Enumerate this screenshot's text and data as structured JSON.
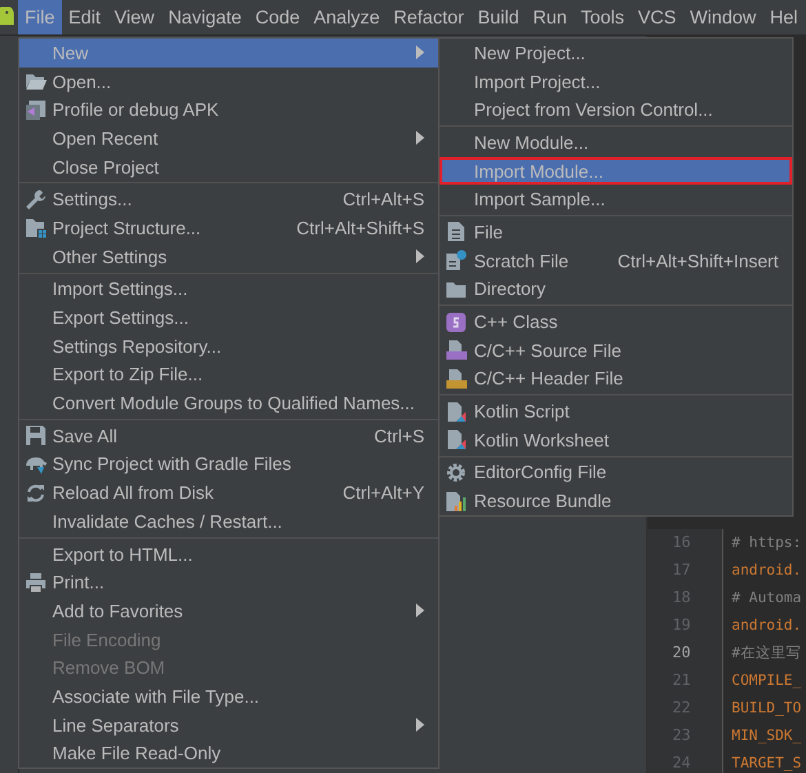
{
  "menu_bar": [
    {
      "label": "File",
      "selected": true
    },
    {
      "label": "Edit",
      "selected": false
    },
    {
      "label": "View",
      "selected": false
    },
    {
      "label": "Navigate",
      "selected": false
    },
    {
      "label": "Code",
      "selected": false
    },
    {
      "label": "Analyze",
      "selected": false
    },
    {
      "label": "Refactor",
      "selected": false
    },
    {
      "label": "Build",
      "selected": false
    },
    {
      "label": "Run",
      "selected": false
    },
    {
      "label": "Tools",
      "selected": false
    },
    {
      "label": "VCS",
      "selected": false
    },
    {
      "label": "Window",
      "selected": false
    },
    {
      "label": "Hel",
      "selected": false
    }
  ],
  "file_menu": [
    {
      "kind": "item",
      "label": "New",
      "submenu": true,
      "selected": true,
      "disabled": false
    },
    {
      "kind": "item",
      "label": "Open...",
      "selected": false,
      "disabled": false
    },
    {
      "kind": "item",
      "label": "Profile or debug APK",
      "selected": false,
      "disabled": false
    },
    {
      "kind": "item",
      "label": "Open Recent",
      "submenu": true,
      "selected": false,
      "disabled": false
    },
    {
      "kind": "item",
      "label": "Close Project",
      "selected": false,
      "disabled": false
    },
    {
      "kind": "separator"
    },
    {
      "kind": "item",
      "label": "Settings...",
      "shortcut": "Ctrl+Alt+S",
      "selected": false,
      "disabled": false
    },
    {
      "kind": "item",
      "label": "Project Structure...",
      "shortcut": "Ctrl+Alt+Shift+S",
      "selected": false,
      "disabled": false
    },
    {
      "kind": "item",
      "label": "Other Settings",
      "submenu": true,
      "selected": false,
      "disabled": false
    },
    {
      "kind": "separator"
    },
    {
      "kind": "item",
      "label": "Import Settings...",
      "selected": false,
      "disabled": false
    },
    {
      "kind": "item",
      "label": "Export Settings...",
      "selected": false,
      "disabled": false
    },
    {
      "kind": "item",
      "label": "Settings Repository...",
      "selected": false,
      "disabled": false
    },
    {
      "kind": "item",
      "label": "Export to Zip File...",
      "selected": false,
      "disabled": false
    },
    {
      "kind": "item",
      "label": "Convert Module Groups to Qualified Names...",
      "selected": false,
      "disabled": false
    },
    {
      "kind": "separator"
    },
    {
      "kind": "item",
      "label": "Save All",
      "shortcut": "Ctrl+S",
      "selected": false,
      "disabled": false
    },
    {
      "kind": "item",
      "label": "Sync Project with Gradle Files",
      "selected": false,
      "disabled": false
    },
    {
      "kind": "item",
      "label": "Reload All from Disk",
      "shortcut": "Ctrl+Alt+Y",
      "selected": false,
      "disabled": false
    },
    {
      "kind": "item",
      "label": "Invalidate Caches / Restart...",
      "selected": false,
      "disabled": false
    },
    {
      "kind": "separator"
    },
    {
      "kind": "item",
      "label": "Export to HTML...",
      "selected": false,
      "disabled": false
    },
    {
      "kind": "item",
      "label": "Print...",
      "selected": false,
      "disabled": false
    },
    {
      "kind": "item",
      "label": "Add to Favorites",
      "submenu": true,
      "selected": false,
      "disabled": false
    },
    {
      "kind": "item",
      "label": "File Encoding",
      "selected": false,
      "disabled": true
    },
    {
      "kind": "item",
      "label": "Remove BOM",
      "selected": false,
      "disabled": true
    },
    {
      "kind": "item",
      "label": "Associate with File Type...",
      "selected": false,
      "disabled": false
    },
    {
      "kind": "item",
      "label": "Line Separators",
      "submenu": true,
      "selected": false,
      "disabled": false
    },
    {
      "kind": "item",
      "label": "Make File Read-Only",
      "selected": false,
      "disabled": false
    }
  ],
  "new_submenu": [
    {
      "kind": "item",
      "label": "New Project...",
      "selected": false,
      "disabled": false
    },
    {
      "kind": "item",
      "label": "Import Project...",
      "selected": false,
      "disabled": false
    },
    {
      "kind": "item",
      "label": "Project from Version Control...",
      "selected": false,
      "disabled": false
    },
    {
      "kind": "separator"
    },
    {
      "kind": "item",
      "label": "New Module...",
      "selected": false,
      "disabled": false
    },
    {
      "kind": "item",
      "label": "Import Module...",
      "selected": true,
      "annotated": true,
      "disabled": false
    },
    {
      "kind": "item",
      "label": "Import Sample...",
      "selected": false,
      "disabled": false
    },
    {
      "kind": "separator"
    },
    {
      "kind": "item",
      "label": "File",
      "selected": false,
      "disabled": false
    },
    {
      "kind": "item",
      "label": "Scratch File",
      "shortcut": "Ctrl+Alt+Shift+Insert",
      "selected": false,
      "disabled": false
    },
    {
      "kind": "item",
      "label": "Directory",
      "selected": false,
      "disabled": false
    },
    {
      "kind": "separator"
    },
    {
      "kind": "item",
      "label": "C++ Class",
      "selected": false,
      "disabled": false
    },
    {
      "kind": "item",
      "label": "C/C++ Source File",
      "selected": false,
      "disabled": false
    },
    {
      "kind": "item",
      "label": "C/C++ Header File",
      "selected": false,
      "disabled": false
    },
    {
      "kind": "separator"
    },
    {
      "kind": "item",
      "label": "Kotlin Script",
      "selected": false,
      "disabled": false
    },
    {
      "kind": "item",
      "label": "Kotlin Worksheet",
      "selected": false,
      "disabled": false
    },
    {
      "kind": "separator"
    },
    {
      "kind": "item",
      "label": "EditorConfig File",
      "selected": false,
      "disabled": false
    },
    {
      "kind": "item",
      "label": "Resource Bundle",
      "selected": false,
      "disabled": false
    }
  ],
  "editor": {
    "lines": [
      {
        "number": "16",
        "text": "# https:",
        "kind": "comment",
        "current": false
      },
      {
        "number": "17",
        "text": "android.",
        "kind": "key",
        "current": false
      },
      {
        "number": "18",
        "text": "# Automa",
        "kind": "comment",
        "current": false
      },
      {
        "number": "19",
        "text": "android.",
        "kind": "key",
        "current": false
      },
      {
        "number": "20",
        "text": "#在这里写",
        "kind": "comment",
        "current": true
      },
      {
        "number": "21",
        "text": "COMPILE_",
        "kind": "key",
        "current": false
      },
      {
        "number": "22",
        "text": "BUILD_TO",
        "kind": "key",
        "current": false
      },
      {
        "number": "23",
        "text": "MIN_SDK_",
        "kind": "key",
        "current": false
      },
      {
        "number": "24",
        "text": "TARGET_S",
        "kind": "key",
        "current": false
      }
    ]
  }
}
